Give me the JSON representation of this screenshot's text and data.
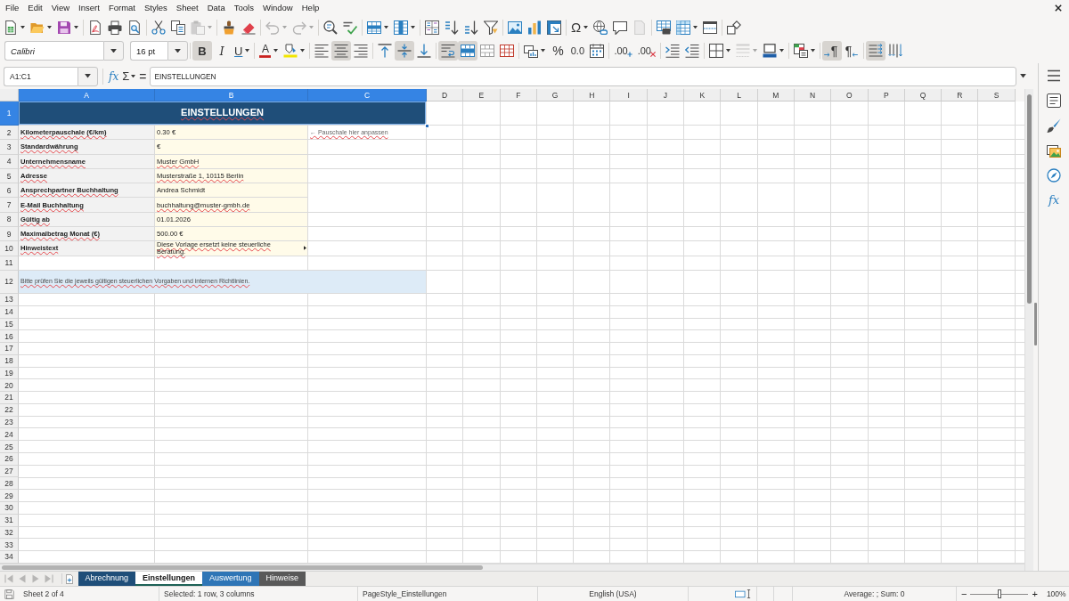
{
  "menu": [
    "File",
    "Edit",
    "View",
    "Insert",
    "Format",
    "Styles",
    "Sheet",
    "Data",
    "Tools",
    "Window",
    "Help"
  ],
  "standard_toolbar": [
    [
      {
        "kind": "new",
        "dropdown": true,
        "disabled": false
      },
      {
        "kind": "open",
        "dropdown": true,
        "disabled": false
      },
      {
        "kind": "save",
        "dropdown": true,
        "disabled": false
      }
    ],
    [
      {
        "kind": "pdf",
        "dropdown": false,
        "disabled": false
      },
      {
        "kind": "print",
        "dropdown": false,
        "disabled": false
      },
      {
        "kind": "preview",
        "dropdown": false,
        "disabled": false
      }
    ],
    [
      {
        "kind": "cut",
        "dropdown": false,
        "disabled": false
      },
      {
        "kind": "copy",
        "dropdown": false,
        "disabled": false
      },
      {
        "kind": "paste",
        "dropdown": true,
        "disabled": true
      }
    ],
    [
      {
        "kind": "clone",
        "dropdown": false,
        "disabled": false
      },
      {
        "kind": "clear",
        "dropdown": false,
        "disabled": false
      }
    ],
    [
      {
        "kind": "undo",
        "dropdown": true,
        "disabled": true
      },
      {
        "kind": "redo",
        "dropdown": true,
        "disabled": true
      }
    ],
    [
      {
        "kind": "find",
        "dropdown": false,
        "disabled": false
      },
      {
        "kind": "spell",
        "dropdown": false,
        "disabled": false
      }
    ],
    [
      {
        "kind": "row",
        "dropdown": true,
        "disabled": false
      },
      {
        "kind": "column",
        "dropdown": true,
        "disabled": false
      }
    ],
    [
      {
        "kind": "sort",
        "dropdown": false,
        "disabled": false
      },
      {
        "kind": "sortasc",
        "dropdown": false,
        "disabled": false
      },
      {
        "kind": "sortdesc",
        "dropdown": false,
        "disabled": false
      },
      {
        "kind": "filter",
        "dropdown": false,
        "disabled": false
      }
    ],
    [
      {
        "kind": "image",
        "dropdown": false,
        "disabled": false
      },
      {
        "kind": "chart",
        "dropdown": false,
        "disabled": false
      },
      {
        "kind": "pivot",
        "dropdown": false,
        "disabled": false
      }
    ],
    [
      {
        "kind": "special",
        "label": "Ω",
        "dropdown": true,
        "disabled": false
      },
      {
        "kind": "link",
        "dropdown": false,
        "disabled": false
      },
      {
        "kind": "comment",
        "dropdown": false,
        "disabled": false
      },
      {
        "kind": "headerfooter",
        "dropdown": false,
        "disabled": true
      }
    ],
    [
      {
        "kind": "printarea",
        "dropdown": false,
        "disabled": false
      },
      {
        "kind": "freeze",
        "dropdown": true,
        "disabled": false
      },
      {
        "kind": "split",
        "dropdown": false,
        "disabled": false
      }
    ],
    [
      {
        "kind": "shapes",
        "dropdown": false,
        "disabled": false
      }
    ]
  ],
  "formatting_toolbar": {
    "font_name": "Calibri",
    "font_size": "16 pt",
    "groups": [
      [
        {
          "kind": "bold",
          "label": "B",
          "on": true,
          "dropdown": false,
          "disabled": false
        },
        {
          "kind": "italic",
          "label": "I",
          "on": false,
          "dropdown": false,
          "disabled": false
        },
        {
          "kind": "underline",
          "label": "U",
          "on": false,
          "dropdown": true,
          "disabled": false
        }
      ],
      [
        {
          "kind": "fontcolor",
          "label": "A",
          "on": false,
          "dropdown": true,
          "disabled": false
        },
        {
          "kind": "highlight",
          "on": false,
          "dropdown": true,
          "disabled": false
        }
      ],
      [
        {
          "kind": "alignleft",
          "on": false,
          "dropdown": false,
          "disabled": false
        },
        {
          "kind": "aligncenter",
          "on": true,
          "dropdown": false,
          "disabled": false
        },
        {
          "kind": "alignright",
          "on": false,
          "dropdown": false,
          "disabled": false
        }
      ],
      [
        {
          "kind": "aligntop",
          "on": false,
          "dropdown": false,
          "disabled": false
        },
        {
          "kind": "alignmiddle",
          "on": true,
          "dropdown": false,
          "disabled": false
        },
        {
          "kind": "alignbottom",
          "on": false,
          "dropdown": false,
          "disabled": false
        }
      ],
      [
        {
          "kind": "wrap",
          "on": true,
          "dropdown": false,
          "disabled": false
        },
        {
          "kind": "mergecenter",
          "on": true,
          "dropdown": false,
          "disabled": false
        },
        {
          "kind": "merge",
          "on": false,
          "dropdown": false,
          "disabled": false
        },
        {
          "kind": "unmerge",
          "on": false,
          "dropdown": false,
          "disabled": false
        }
      ],
      [
        {
          "kind": "currency",
          "on": false,
          "dropdown": true,
          "disabled": false
        },
        {
          "kind": "percent",
          "label": "%",
          "on": false,
          "dropdown": false,
          "disabled": false
        },
        {
          "kind": "number",
          "label": "0.0",
          "on": false,
          "dropdown": false,
          "disabled": false
        },
        {
          "kind": "date",
          "on": false,
          "dropdown": false,
          "disabled": false
        }
      ],
      [
        {
          "kind": "adddecimal",
          "label": ".00",
          "on": false,
          "dropdown": false,
          "disabled": false
        },
        {
          "kind": "deletedecimal",
          "label": ".00",
          "on": false,
          "dropdown": false,
          "disabled": false
        }
      ],
      [
        {
          "kind": "indent",
          "on": false,
          "dropdown": false,
          "disabled": false
        },
        {
          "kind": "outdent",
          "on": false,
          "dropdown": false,
          "disabled": false
        }
      ],
      [
        {
          "kind": "borders",
          "on": false,
          "dropdown": true,
          "disabled": false
        },
        {
          "kind": "borderstyle",
          "on": false,
          "dropdown": true,
          "disabled": true
        },
        {
          "kind": "bordercolor",
          "on": false,
          "dropdown": true,
          "disabled": false
        }
      ],
      [
        {
          "kind": "conditional",
          "on": false,
          "dropdown": true,
          "disabled": false
        }
      ],
      [
        {
          "kind": "ltr",
          "label": "¶",
          "on": true,
          "dropdown": false,
          "disabled": false
        },
        {
          "kind": "rtl",
          "label": "¶",
          "on": false,
          "dropdown": false,
          "disabled": false
        }
      ],
      [
        {
          "kind": "textltr",
          "on": true,
          "dropdown": false,
          "disabled": false
        },
        {
          "kind": "textttb",
          "on": false,
          "dropdown": false,
          "disabled": false
        }
      ]
    ]
  },
  "formula_bar": {
    "name_box": "A1:C1",
    "tools": [
      {
        "kind": "wizard",
        "label": "fx",
        "dropdown": false
      },
      {
        "kind": "sum",
        "label": "Σ",
        "dropdown": true
      },
      {
        "kind": "formula",
        "label": "=",
        "dropdown": false
      }
    ],
    "content": "EINSTELLUNGEN"
  },
  "columns": [
    {
      "label": "A",
      "selected": true
    },
    {
      "label": "B",
      "selected": true
    },
    {
      "label": "C",
      "selected": true
    },
    {
      "label": "D",
      "selected": false
    },
    {
      "label": "E",
      "selected": false
    },
    {
      "label": "F",
      "selected": false
    },
    {
      "label": "G",
      "selected": false
    },
    {
      "label": "H",
      "selected": false
    },
    {
      "label": "I",
      "selected": false
    },
    {
      "label": "J",
      "selected": false
    },
    {
      "label": "K",
      "selected": false
    },
    {
      "label": "L",
      "selected": false
    },
    {
      "label": "M",
      "selected": false
    },
    {
      "label": "N",
      "selected": false
    },
    {
      "label": "O",
      "selected": false
    },
    {
      "label": "P",
      "selected": false
    },
    {
      "label": "Q",
      "selected": false
    },
    {
      "label": "R",
      "selected": false
    },
    {
      "label": "S",
      "selected": false
    }
  ],
  "rows": [
    {
      "number": "1",
      "selected": true,
      "cells": [
        {
          "kind": "title",
          "text": "EINSTELLUNGEN",
          "spell_error": true,
          "clipped": false
        }
      ]
    },
    {
      "number": "2",
      "selected": false,
      "cells": [
        {
          "kind": "label",
          "text": "Kilometerpauschale (€/km)",
          "spell_error": true,
          "clipped": false
        },
        {
          "kind": "value",
          "text": "0.30 €",
          "spell_error": false,
          "clipped": false
        },
        {
          "kind": "note",
          "text": "← Pauschale hier anpassen",
          "spell_error": true,
          "clipped": false
        }
      ]
    },
    {
      "number": "3",
      "selected": false,
      "cells": [
        {
          "kind": "label",
          "text": "Standardwährung",
          "spell_error": true,
          "clipped": false
        },
        {
          "kind": "value",
          "text": "€",
          "spell_error": false,
          "clipped": false
        }
      ]
    },
    {
      "number": "4",
      "selected": false,
      "cells": [
        {
          "kind": "label",
          "text": "Unternehmensname",
          "spell_error": true,
          "clipped": false
        },
        {
          "kind": "value",
          "text": "Muster GmbH",
          "spell_error": true,
          "clipped": false
        }
      ]
    },
    {
      "number": "5",
      "selected": false,
      "cells": [
        {
          "kind": "label",
          "text": "Adresse",
          "spell_error": true,
          "clipped": false
        },
        {
          "kind": "value",
          "text": "Musterstraße 1, 10115 Berlin",
          "spell_error": true,
          "clipped": false
        }
      ]
    },
    {
      "number": "6",
      "selected": false,
      "cells": [
        {
          "kind": "label",
          "text": "Ansprechpartner Buchhaltung",
          "spell_error": true,
          "clipped": false
        },
        {
          "kind": "value",
          "text": "Andrea Schmidt",
          "spell_error": false,
          "clipped": false
        }
      ]
    },
    {
      "number": "7",
      "selected": false,
      "cells": [
        {
          "kind": "label",
          "text": "E-Mail Buchhaltung",
          "spell_error": true,
          "clipped": false
        },
        {
          "kind": "value",
          "text": "buchhaltung@muster-gmbh.de",
          "spell_error": true,
          "clipped": false
        }
      ]
    },
    {
      "number": "8",
      "selected": false,
      "cells": [
        {
          "kind": "label",
          "text": "Gültig ab",
          "spell_error": true,
          "clipped": false
        },
        {
          "kind": "value",
          "text": "01.01.2026",
          "spell_error": false,
          "clipped": false
        }
      ]
    },
    {
      "number": "9",
      "selected": false,
      "cells": [
        {
          "kind": "label",
          "text": "Maximalbetrag Monat (€)",
          "spell_error": true,
          "clipped": false
        },
        {
          "kind": "value",
          "text": "500.00 €",
          "spell_error": false,
          "clipped": false
        }
      ]
    },
    {
      "number": "10",
      "selected": false,
      "cells": [
        {
          "kind": "label",
          "text": "Hinweistext",
          "spell_error": true,
          "clipped": false
        },
        {
          "kind": "value",
          "text": "Diese Vorlage ersetzt keine steuerliche Beratung.",
          "spell_error": true,
          "clipped": true
        }
      ]
    },
    {
      "number": "11",
      "selected": false
    },
    {
      "number": "12",
      "selected": false,
      "cells": [
        {
          "kind": "banner",
          "text": "Bitte prüfen Sie die jeweils gültigen steuerlichen Vorgaben und internen Richtlinien.",
          "spell_error": true,
          "clipped": false
        }
      ]
    },
    {
      "number": "13",
      "selected": false
    },
    {
      "number": "14",
      "selected": false
    },
    {
      "number": "15",
      "selected": false
    },
    {
      "number": "16",
      "selected": false
    },
    {
      "number": "17",
      "selected": false
    },
    {
      "number": "18",
      "selected": false
    },
    {
      "number": "19",
      "selected": false
    },
    {
      "number": "20",
      "selected": false
    },
    {
      "number": "21",
      "selected": false
    },
    {
      "number": "22",
      "selected": false
    },
    {
      "number": "23",
      "selected": false
    },
    {
      "number": "24",
      "selected": false
    },
    {
      "number": "25",
      "selected": false
    },
    {
      "number": "26",
      "selected": false
    },
    {
      "number": "27",
      "selected": false
    },
    {
      "number": "28",
      "selected": false
    },
    {
      "number": "29",
      "selected": false
    },
    {
      "number": "30",
      "selected": false
    },
    {
      "number": "31",
      "selected": false
    },
    {
      "number": "32",
      "selected": false
    },
    {
      "number": "33",
      "selected": false
    },
    {
      "number": "34",
      "selected": false
    }
  ],
  "sidebar": [
    {
      "kind": "menu"
    },
    {
      "kind": "properties"
    },
    {
      "kind": "styles"
    },
    {
      "kind": "gallery"
    },
    {
      "kind": "navigator"
    },
    {
      "kind": "functions",
      "label": "fx"
    }
  ],
  "sheet_nav": [
    {
      "kind": "first",
      "disabled": true
    },
    {
      "kind": "previous",
      "disabled": true
    },
    {
      "kind": "next",
      "disabled": true
    },
    {
      "kind": "last",
      "disabled": true
    }
  ],
  "sheet_tabs": [
    {
      "label": "Abrechnung",
      "selected": false,
      "color": "#1f4e79"
    },
    {
      "label": "Einstellungen",
      "selected": true,
      "color": "#1d6156"
    },
    {
      "label": "Auswertung",
      "selected": false,
      "color": "#2e75b6"
    },
    {
      "label": "Hinweise",
      "selected": false,
      "color": "#595959"
    }
  ],
  "status_bar": {
    "sheet": "Sheet 2 of 4",
    "selection": "Selected: 1 row, 3 columns",
    "page_style": "PageStyle_Einstellungen",
    "language": "English (USA)",
    "sum": "Average: ; Sum: 0",
    "zoom_out": "−",
    "zoom": {
      "level": 0.5
    },
    "zoom_in": "+",
    "zoom_value": "100%"
  }
}
